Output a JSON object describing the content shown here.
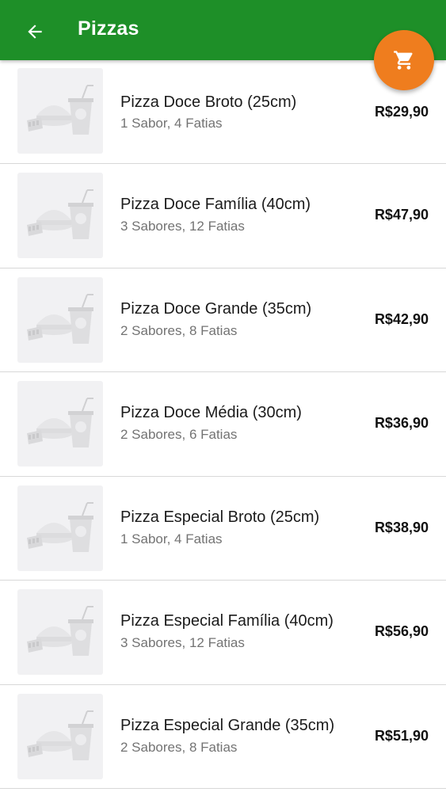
{
  "header": {
    "title": "Pizzas",
    "back_icon": "arrow-left-icon",
    "background": "#1e8f28"
  },
  "cart_button": {
    "icon": "shopping-cart-icon",
    "color": "#ef7d1e"
  },
  "products": [
    {
      "name": "Pizza Doce Broto (25cm)",
      "description": "1 Sabor, 4 Fatias",
      "price": "R$29,90"
    },
    {
      "name": "Pizza Doce Família (40cm)",
      "description": "3 Sabores, 12 Fatias",
      "price": "R$47,90"
    },
    {
      "name": "Pizza Doce Grande (35cm)",
      "description": "2 Sabores, 8 Fatias",
      "price": "R$42,90"
    },
    {
      "name": "Pizza Doce Média (30cm)",
      "description": "2 Sabores, 6 Fatias",
      "price": "R$36,90"
    },
    {
      "name": "Pizza Especial Broto (25cm)",
      "description": "1 Sabor, 4 Fatias",
      "price": "R$38,90"
    },
    {
      "name": "Pizza Especial Família (40cm)",
      "description": "3 Sabores, 12 Fatias",
      "price": "R$56,90"
    },
    {
      "name": "Pizza Especial Grande (35cm)",
      "description": "2 Sabores, 8 Fatias",
      "price": "R$51,90"
    }
  ]
}
